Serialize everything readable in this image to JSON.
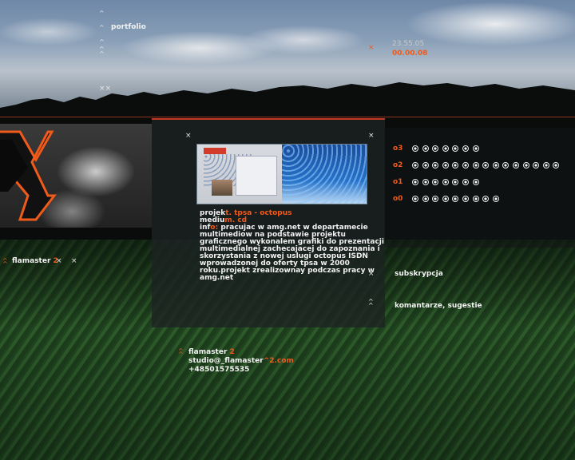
{
  "nav": {
    "portfolio_label": "portfolio"
  },
  "datetime": {
    "date": "23.55.05",
    "time": "00.00.08"
  },
  "sidebar": {
    "brand_prefix": "flamaster",
    "brand_suffix": "2"
  },
  "project": {
    "label_prefix": "projek",
    "label_suffix": "t. tpsa - octopus",
    "medium_prefix": "mediu",
    "medium_suffix": "m. cd",
    "info_prefix": "inf",
    "info_suffix": "o:",
    "info_lines": [
      "pracujac w amg.net w departamecie",
      "multimediow na podstawie projektu",
      "graficznego wykonalem grafiki do prezentacji",
      "multimedialnej zachecajacej do zapoznania i",
      "skorzystania z nowej uslugi octopus ISDN",
      "wprowadzonej do oferty tpsa w 2000",
      "roku.projekt zrealizownay podczas pracy w",
      "amg.net"
    ]
  },
  "levels": [
    {
      "label": "o3",
      "count": 7
    },
    {
      "label": "o2",
      "count": 15
    },
    {
      "label": "o1",
      "count": 7
    },
    {
      "label": "o0",
      "count": 9
    }
  ],
  "links": {
    "subscription": "subskrypcja",
    "comments": "komantarze, sugestie"
  },
  "contact": {
    "name_prefix": "flamaster",
    "name_suffix": "2",
    "email_prefix": "studio@_flamaster",
    "email_suffix": "^2.com",
    "phone": "+48501575535"
  },
  "colors": {
    "accent": "#f05a1a",
    "line": "#b13a24"
  }
}
